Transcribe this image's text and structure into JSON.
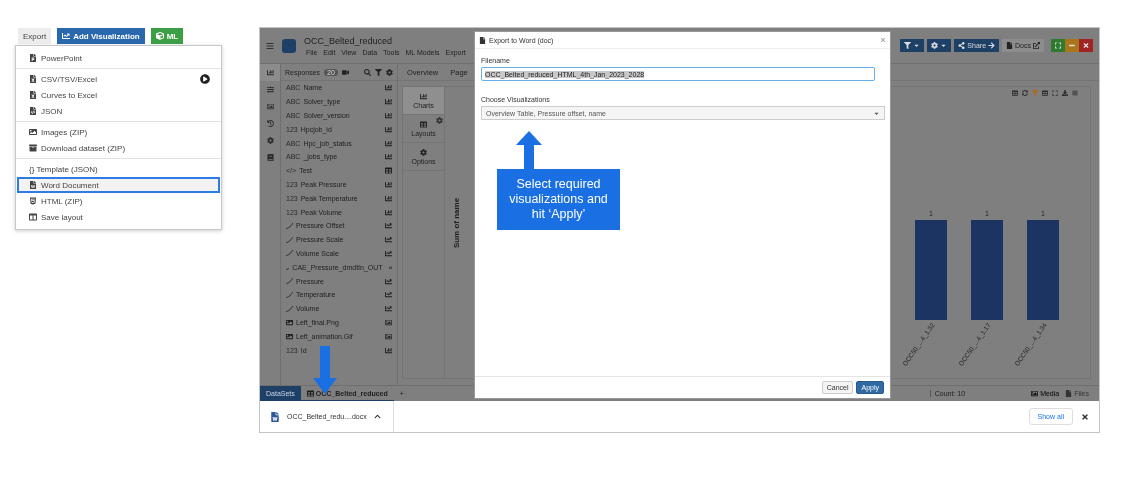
{
  "export_menu": {
    "buttons": [
      {
        "label": "Export",
        "kind": "plain"
      },
      {
        "label": "Add Visualization",
        "kind": "primary"
      },
      {
        "label": "ML",
        "kind": "success"
      }
    ],
    "groups": [
      [
        {
          "label": "PowerPoint",
          "selected": false,
          "submenu": false
        }
      ],
      [
        {
          "label": "CSV/TSV/Excel",
          "selected": false,
          "submenu": true
        },
        {
          "label": "Curves to Excel",
          "selected": false,
          "submenu": false
        },
        {
          "label": "JSON",
          "selected": false,
          "submenu": false
        }
      ],
      [
        {
          "label": "Images (ZIP)",
          "selected": false,
          "submenu": false
        },
        {
          "label": "Download dataset (ZIP)",
          "selected": false,
          "submenu": false
        }
      ],
      [
        {
          "label": "{} Template (JSON)",
          "selected": false,
          "submenu": false
        },
        {
          "label": "Word Document",
          "selected": true,
          "submenu": false
        },
        {
          "label": "HTML (ZIP)",
          "selected": false,
          "submenu": false
        },
        {
          "label": "Save layout",
          "selected": false,
          "submenu": false
        }
      ]
    ]
  },
  "app": {
    "title": "OCC_Belted_reduced",
    "menu": [
      "File",
      "Edit",
      "View",
      "Data",
      "Tools",
      "ML Models",
      "Export"
    ],
    "toolbar": [
      {
        "kind": "filter"
      },
      {
        "kind": "settings"
      },
      {
        "kind": "share",
        "label": "Share"
      },
      {
        "kind": "docs",
        "label": "Docs"
      }
    ],
    "window_controls": [
      {
        "kind": "maximize"
      },
      {
        "kind": "minimize"
      },
      {
        "kind": "close"
      }
    ],
    "rail": [
      {
        "selected": true
      },
      {
        "selected": false
      },
      {
        "selected": false
      },
      {
        "selected": false
      },
      {
        "selected": false
      },
      {
        "selected": false
      }
    ],
    "responses": {
      "title": "Responses",
      "count": "20",
      "fields": [
        {
          "kind": "text",
          "type_label": "ABC",
          "name": "Name"
        },
        {
          "kind": "text",
          "type_label": "ABC",
          "name": "Solver_type"
        },
        {
          "kind": "text",
          "type_label": "ABC",
          "name": "Solver_version"
        },
        {
          "kind": "number",
          "type_label": "123",
          "name": "Hpcjob_id"
        },
        {
          "kind": "text",
          "type_label": "ABC",
          "name": "Hpc_job_status"
        },
        {
          "kind": "text",
          "type_label": "ABC",
          "name": "_jobs_type"
        },
        {
          "kind": "html",
          "type_label": "</>",
          "name": "Test"
        },
        {
          "kind": "number",
          "type_label": "123",
          "name": "Peak Pressure"
        },
        {
          "kind": "number",
          "type_label": "123",
          "name": "Peak Temperature"
        },
        {
          "kind": "number",
          "type_label": "123",
          "name": "Peak Volume"
        },
        {
          "kind": "curve",
          "name": "Pressure Offset"
        },
        {
          "kind": "curve",
          "name": "Pressure Scale"
        },
        {
          "kind": "curve",
          "name": "Volume Scale"
        },
        {
          "kind": "curve",
          "name": "CAE_Pressure_dmdtIn_OUT"
        },
        {
          "kind": "curve",
          "name": "Pressure"
        },
        {
          "kind": "curve",
          "name": "Temperature"
        },
        {
          "kind": "curve",
          "name": "Volume"
        },
        {
          "kind": "image",
          "name": "Left_final.Png"
        },
        {
          "kind": "image",
          "name": "Left_animation.Gif"
        },
        {
          "kind": "number",
          "type_label": "123",
          "name": "Id"
        }
      ]
    },
    "side_tabs": [
      {
        "label": "Charts",
        "selected": true,
        "has_settings": false
      },
      {
        "label": "Layouts",
        "selected": false,
        "has_settings": true
      },
      {
        "label": "Options",
        "selected": false,
        "has_settings": false
      }
    ],
    "page_tabs": [
      "Overview",
      "Page"
    ],
    "chart": {
      "chart_data": {
        "type": "bar",
        "annotations": [
          "Sum of name"
        ],
        "categories": [
          "OCC50_...4_1.32",
          "OCC50_...4_1.17",
          "OCC50_...4_1.34"
        ],
        "values": [
          1,
          1,
          1
        ],
        "data_labels": true
      }
    },
    "bottom_tabs": [
      {
        "label": "DataSets",
        "kind": "datasets"
      },
      {
        "label": "OCC_Belted_reduced",
        "kind": "file"
      },
      {
        "label": "+",
        "kind": "add"
      }
    ],
    "status": {
      "count": "Count: 10",
      "items": [
        {
          "label": "Media",
          "disabled": false
        },
        {
          "label": "Files",
          "disabled": true
        }
      ]
    }
  },
  "dialog": {
    "title": "Export to Word (doc)",
    "filename_label": "Filename",
    "filename": "OCC_Belted_reduced_HTML_4th_Jan_2023_2028",
    "visualizations_label": "Choose Visualizations",
    "visualizations": "Overview Table, Pressure offset, name",
    "buttons": [
      {
        "label": "Cancel",
        "kind": "secondary"
      },
      {
        "label": "Apply",
        "kind": "primary"
      }
    ]
  },
  "download_bar": {
    "file": "OCC_Belted_redu....docx",
    "show_all": "Show all"
  },
  "callout": "Select required visualizations and hit ‘Apply’"
}
